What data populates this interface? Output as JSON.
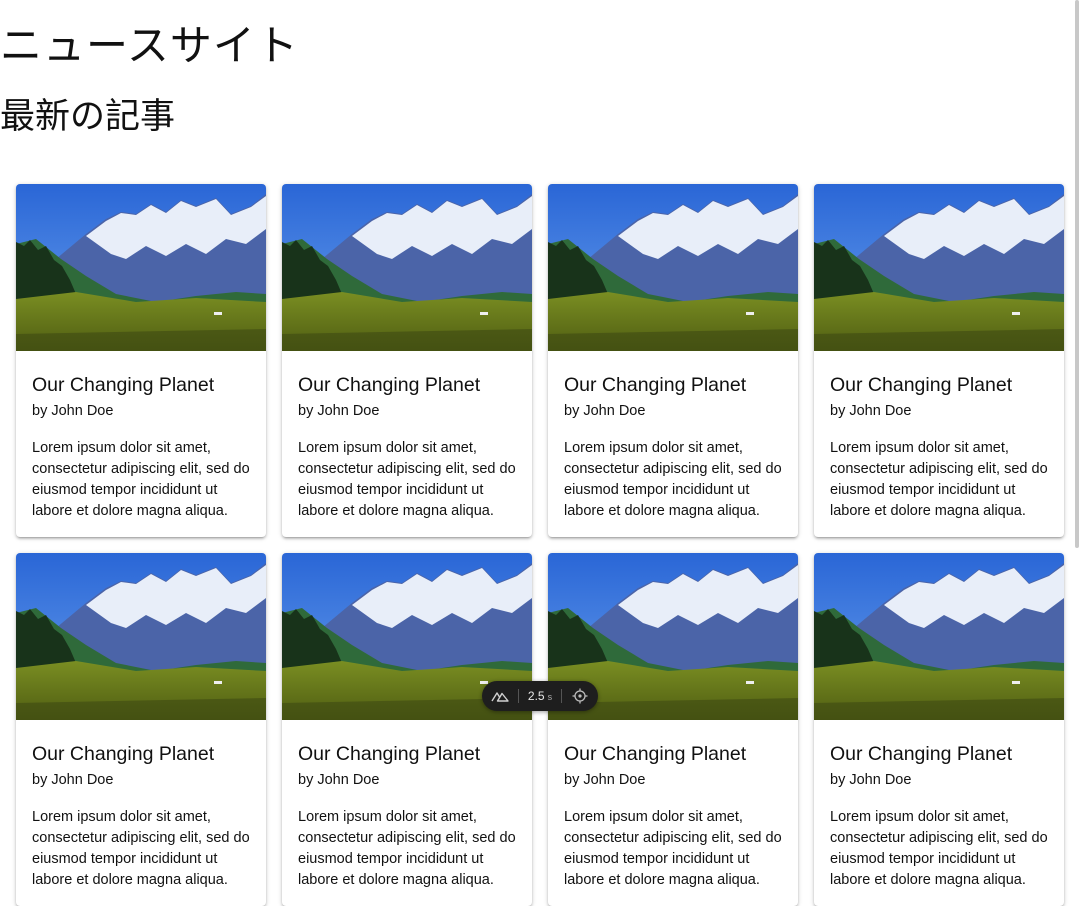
{
  "header": {
    "site_title": "ニュースサイト",
    "section_title": "最新の記事"
  },
  "articles": [
    {
      "title": "Our Changing Planet",
      "author": "by John Doe",
      "text": "Lorem ipsum dolor sit amet, consectetur adipiscing elit, sed do eiusmod tempor incididunt ut labore et dolore magna aliqua.",
      "image": "mountain-landscape"
    },
    {
      "title": "Our Changing Planet",
      "author": "by John Doe",
      "text": "Lorem ipsum dolor sit amet, consectetur adipiscing elit, sed do eiusmod tempor incididunt ut labore et dolore magna aliqua.",
      "image": "mountain-landscape"
    },
    {
      "title": "Our Changing Planet",
      "author": "by John Doe",
      "text": "Lorem ipsum dolor sit amet, consectetur adipiscing elit, sed do eiusmod tempor incididunt ut labore et dolore magna aliqua.",
      "image": "mountain-landscape"
    },
    {
      "title": "Our Changing Planet",
      "author": "by John Doe",
      "text": "Lorem ipsum dolor sit amet, consectetur adipiscing elit, sed do eiusmod tempor incididunt ut labore et dolore magna aliqua.",
      "image": "mountain-landscape"
    },
    {
      "title": "Our Changing Planet",
      "author": "by John Doe",
      "text": "Lorem ipsum dolor sit amet, consectetur adipiscing elit, sed do eiusmod tempor incididunt ut labore et dolore magna aliqua.",
      "image": "mountain-landscape"
    },
    {
      "title": "Our Changing Planet",
      "author": "by John Doe",
      "text": "Lorem ipsum dolor sit amet, consectetur adipiscing elit, sed do eiusmod tempor incididunt ut labore et dolore magna aliqua.",
      "image": "mountain-landscape"
    },
    {
      "title": "Our Changing Planet",
      "author": "by John Doe",
      "text": "Lorem ipsum dolor sit amet, consectetur adipiscing elit, sed do eiusmod tempor incididunt ut labore et dolore magna aliqua.",
      "image": "mountain-landscape"
    },
    {
      "title": "Our Changing Planet",
      "author": "by John Doe",
      "text": "Lorem ipsum dolor sit amet, consectetur adipiscing elit, sed do eiusmod tempor incididunt ut labore et dolore magna aliqua.",
      "image": "mountain-landscape"
    }
  ],
  "devtools": {
    "logo_icon": "nuxt-logo-icon",
    "timing_value": "2.5",
    "timing_unit": "s",
    "inspect_icon": "crosshair-icon"
  },
  "colors": {
    "sky": "#2f6fd8",
    "snow": "#eef3fb",
    "meadow": "#6b7d1c",
    "forest": "#1d3a1c"
  }
}
